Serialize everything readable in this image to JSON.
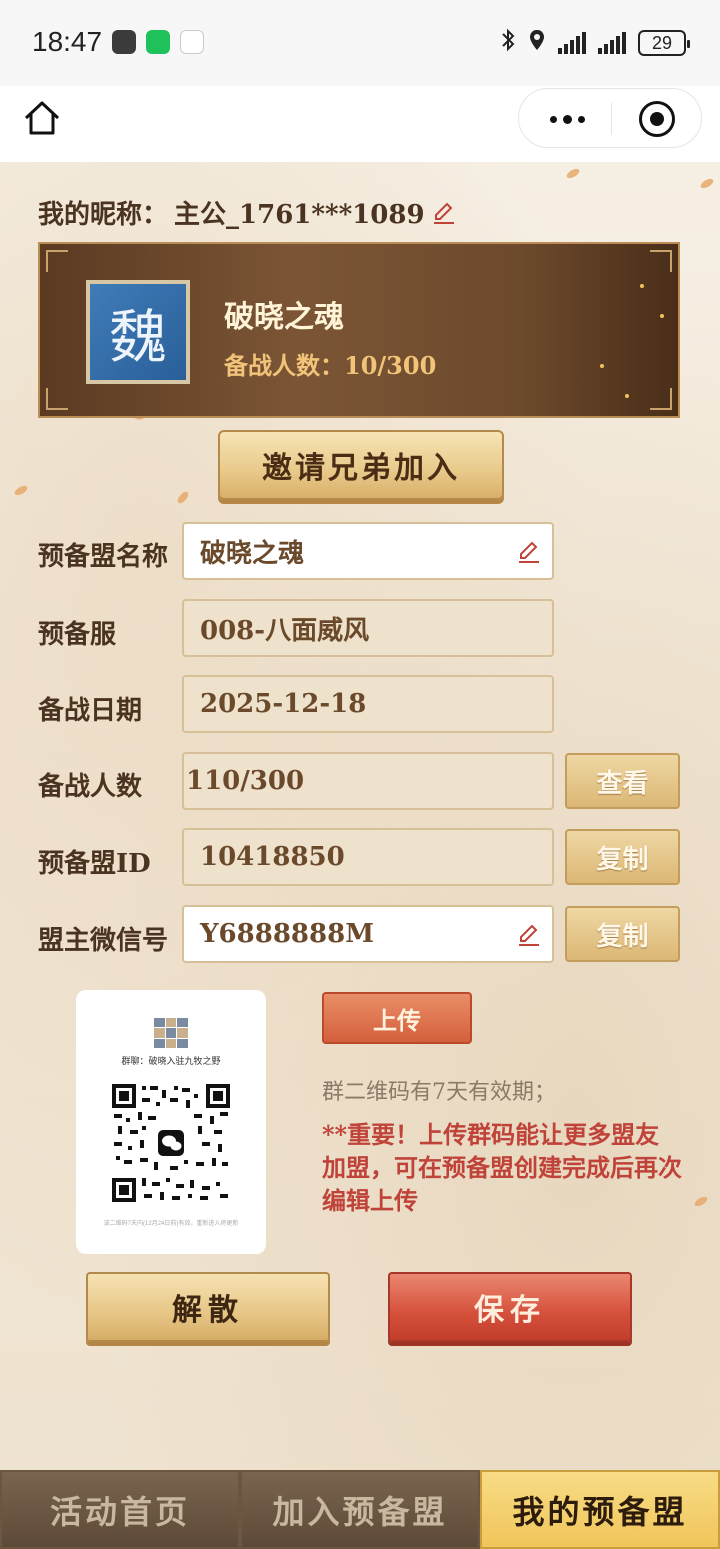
{
  "status_bar": {
    "time": "18:47",
    "battery": "29"
  },
  "nickname": {
    "label": "我的昵称：",
    "value": "主公_1761***1089"
  },
  "guild_card": {
    "emblem_char": "魏",
    "name": "破晓之魂",
    "count_label": "备战人数：",
    "count_value": "10/300"
  },
  "invite_button": "邀请兄弟加入",
  "form": {
    "name": {
      "label": "预备盟名称",
      "value": "破晓之魂"
    },
    "server": {
      "label": "预备服",
      "value": "008-八面威风"
    },
    "date": {
      "label": "备战日期",
      "value": "2025-12-18"
    },
    "members": {
      "label": "备战人数",
      "value": "110/300",
      "button": "查看"
    },
    "alliance_id": {
      "label": "预备盟ID",
      "value": "10418850",
      "button": "复制"
    },
    "wechat": {
      "label": "盟主微信号",
      "value": "Y6888888M",
      "button": "复制"
    }
  },
  "qr": {
    "group_name": "群聊：破晓入驻九牧之野",
    "note": "该二维码7天内(12月24日前)有效，重新进入将更新",
    "upload_button": "上传",
    "validity_text": "群二维码有7天有效期；",
    "important_text": "**重要！上传群码能让更多盟友加盟，可在预备盟创建完成后再次编辑上传"
  },
  "actions": {
    "disband": "解散",
    "save": "保存"
  },
  "bottom_nav": [
    {
      "label": "活动首页",
      "active": false
    },
    {
      "label": "加入预备盟",
      "active": false
    },
    {
      "label": "我的预备盟",
      "active": true
    }
  ],
  "colors": {
    "accent_gold": "#f0c55a",
    "accent_red": "#d5503b",
    "important_red": "#c0433a",
    "emblem_blue": "#3f7cb8"
  }
}
